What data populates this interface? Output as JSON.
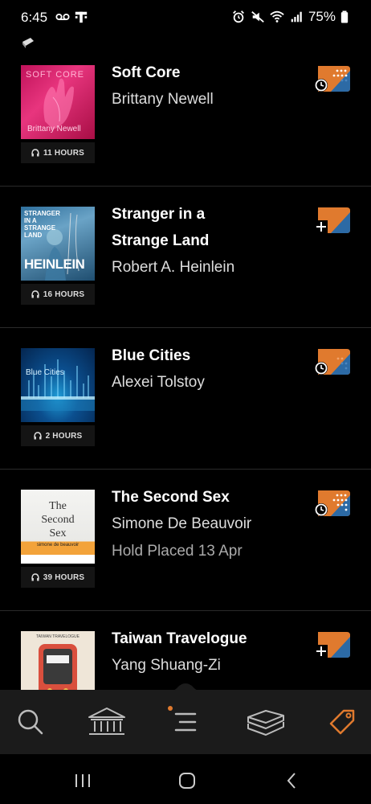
{
  "status_bar": {
    "time": "6:45",
    "battery": "75%",
    "icons": [
      "voicemail-icon",
      "t-mobile-icon",
      "alarm-icon",
      "mute-icon",
      "wifi-icon",
      "signal-icon",
      "battery-icon"
    ]
  },
  "books": [
    {
      "title": "Soft Core",
      "author": "Brittany Newell",
      "duration": "11 HOURS",
      "action": "hold-clock",
      "status": "",
      "cover_text": "SOFT CORE",
      "cover_author": "Brittany Newell"
    },
    {
      "title": "Stranger in a Strange Land",
      "author": "Robert A. Heinlein",
      "duration": "16 HOURS",
      "action": "add-plus",
      "status": "",
      "cover_text": "STRANGER IN A STRANGE LAND",
      "cover_author": "HEINLEIN"
    },
    {
      "title": "Blue Cities",
      "author": "Alexei Tolstoy",
      "duration": "2 HOURS",
      "action": "hold-clock",
      "status": "",
      "cover_text": "Blue Cities",
      "cover_author": ""
    },
    {
      "title": "The Second Sex",
      "author": "Simone De Beauvoir",
      "duration": "39 HOURS",
      "action": "hold-clock",
      "status": "Hold Placed 13 Apr",
      "cover_text": "The Second Sex",
      "cover_author": "simone de beauvoir"
    },
    {
      "title": "Taiwan Travelogue",
      "author": "Yang Shuang-Zi",
      "duration": "",
      "action": "add-plus",
      "status": "",
      "cover_text": "TAIWAN TRAVELOGUE",
      "cover_author": ""
    }
  ],
  "bottom_nav": {
    "items": [
      "search-icon",
      "library-icon",
      "menu-icon",
      "shelf-icon",
      "tag-icon"
    ],
    "active": "tag-icon"
  },
  "system_nav": [
    "recents-icon",
    "home-icon",
    "back-icon"
  ],
  "colors": {
    "accent": "#e07a2e",
    "blue": "#2c6aa5",
    "nav_bg": "#1b1b1b"
  }
}
